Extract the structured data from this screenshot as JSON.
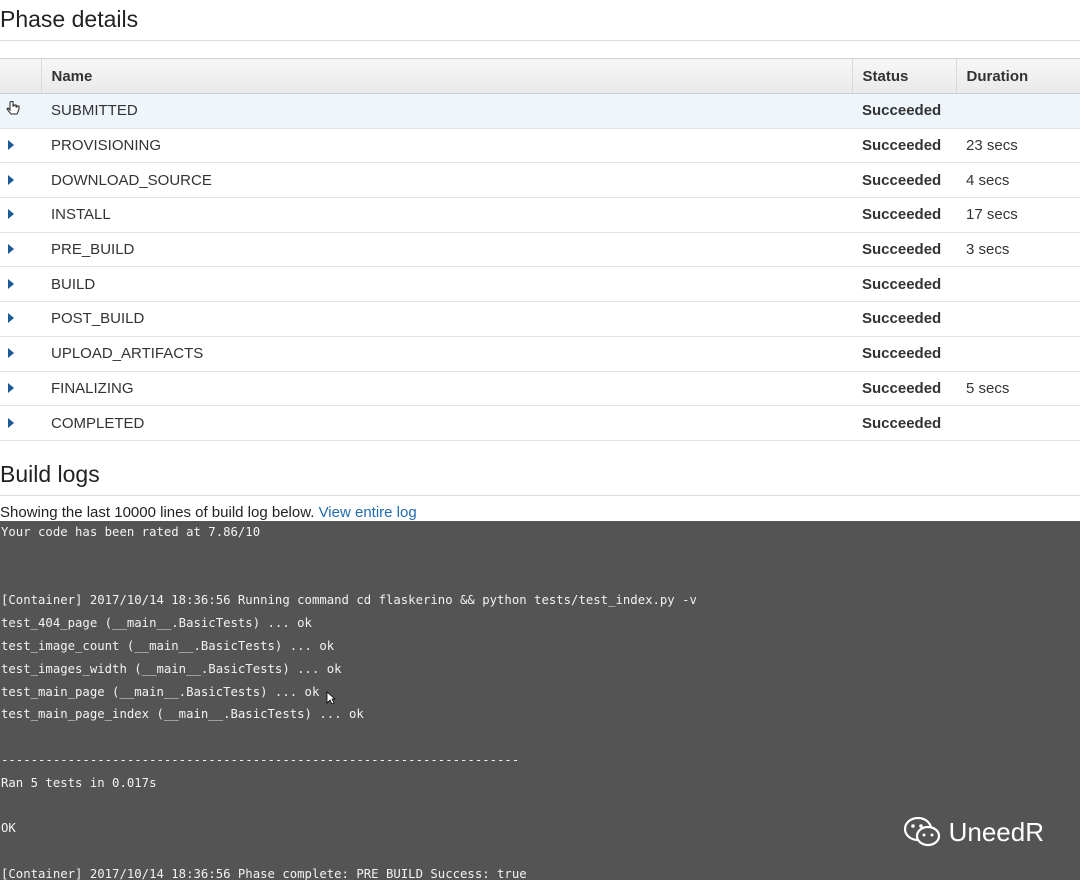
{
  "phase_details": {
    "title": "Phase details",
    "columns": [
      "Name",
      "Status",
      "Duration"
    ],
    "rows": [
      {
        "name": "SUBMITTED",
        "status": "Succeeded",
        "duration": ""
      },
      {
        "name": "PROVISIONING",
        "status": "Succeeded",
        "duration": "23 secs"
      },
      {
        "name": "DOWNLOAD_SOURCE",
        "status": "Succeeded",
        "duration": "4 secs"
      },
      {
        "name": "INSTALL",
        "status": "Succeeded",
        "duration": "17 secs"
      },
      {
        "name": "PRE_BUILD",
        "status": "Succeeded",
        "duration": "3 secs"
      },
      {
        "name": "BUILD",
        "status": "Succeeded",
        "duration": ""
      },
      {
        "name": "POST_BUILD",
        "status": "Succeeded",
        "duration": ""
      },
      {
        "name": "UPLOAD_ARTIFACTS",
        "status": "Succeeded",
        "duration": ""
      },
      {
        "name": "FINALIZING",
        "status": "Succeeded",
        "duration": "5 secs"
      },
      {
        "name": "COMPLETED",
        "status": "Succeeded",
        "duration": ""
      }
    ]
  },
  "build_logs": {
    "title": "Build logs",
    "caption": "Showing the last 10000 lines of build log below.",
    "link": "View entire log",
    "lines": [
      "Your code has been rated at 7.86/10",
      "",
      "",
      "[Container] 2017/10/14 18:36:56 Running command cd flaskerino && python tests/test_index.py -v",
      "test_404_page (__main__.BasicTests) ... ok",
      "test_image_count (__main__.BasicTests) ... ok",
      "test_images_width (__main__.BasicTests) ... ok",
      "test_main_page (__main__.BasicTests) ... ok",
      "test_main_page_index (__main__.BasicTests) ... ok",
      "",
      "----------------------------------------------------------------------",
      "Ran 5 tests in 0.017s",
      "",
      "OK",
      "",
      "[Container] 2017/10/14 18:36:56 Phase complete: PRE_BUILD Success: true"
    ]
  },
  "watermark": {
    "text": "UneedR"
  },
  "colors": {
    "status_success": "#1d8a2a",
    "link": "#1f6bb4",
    "log_bg": "#545454"
  }
}
